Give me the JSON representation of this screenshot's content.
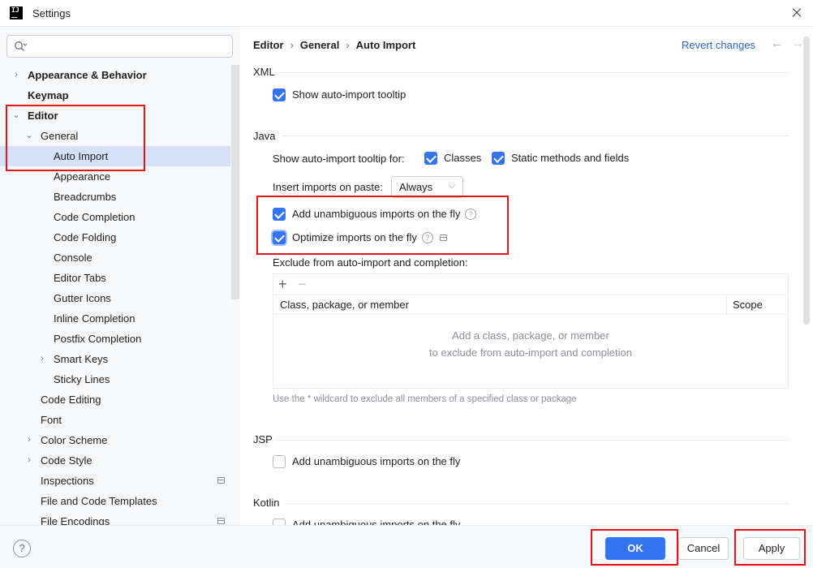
{
  "window": {
    "title": "Settings"
  },
  "search": {
    "placeholder": ""
  },
  "sidebar": {
    "items": [
      {
        "label": "Appearance & Behavior",
        "level": 0,
        "bold": true,
        "expandable": true,
        "expanded": false
      },
      {
        "label": "Keymap",
        "level": 0,
        "bold": true,
        "expandable": false
      },
      {
        "label": "Editor",
        "level": 0,
        "bold": true,
        "expandable": true,
        "expanded": true
      },
      {
        "label": "General",
        "level": 1,
        "bold": false,
        "expandable": true,
        "expanded": true
      },
      {
        "label": "Auto Import",
        "level": 2,
        "bold": false,
        "selected": true
      },
      {
        "label": "Appearance",
        "level": 2
      },
      {
        "label": "Breadcrumbs",
        "level": 2
      },
      {
        "label": "Code Completion",
        "level": 2
      },
      {
        "label": "Code Folding",
        "level": 2
      },
      {
        "label": "Console",
        "level": 2
      },
      {
        "label": "Editor Tabs",
        "level": 2
      },
      {
        "label": "Gutter Icons",
        "level": 2
      },
      {
        "label": "Inline Completion",
        "level": 2
      },
      {
        "label": "Postfix Completion",
        "level": 2
      },
      {
        "label": "Smart Keys",
        "level": 2,
        "expandable": true,
        "expanded": false
      },
      {
        "label": "Sticky Lines",
        "level": 2
      },
      {
        "label": "Code Editing",
        "level": 1
      },
      {
        "label": "Font",
        "level": 1
      },
      {
        "label": "Color Scheme",
        "level": 1,
        "expandable": true,
        "expanded": false
      },
      {
        "label": "Code Style",
        "level": 1,
        "expandable": true,
        "expanded": false
      },
      {
        "label": "Inspections",
        "level": 1,
        "side_icon": true
      },
      {
        "label": "File and Code Templates",
        "level": 1
      },
      {
        "label": "File Encodings",
        "level": 1,
        "side_icon": true
      }
    ]
  },
  "header": {
    "breadcrumb": [
      "Editor",
      "General",
      "Auto Import"
    ],
    "revert_label": "Revert changes"
  },
  "xml": {
    "title": "XML",
    "show_tooltip": {
      "label": "Show auto-import tooltip",
      "checked": true
    }
  },
  "java": {
    "title": "Java",
    "tooltip_for_label": "Show auto-import tooltip for:",
    "classes": {
      "label": "Classes",
      "checked": true
    },
    "static_methods": {
      "label": "Static methods and fields",
      "checked": true
    },
    "insert_on_paste_label": "Insert imports on paste:",
    "insert_on_paste_value": "Always",
    "add_unambiguous": {
      "label": "Add unambiguous imports on the fly",
      "checked": true
    },
    "optimize_imports": {
      "label": "Optimize imports on the fly",
      "checked": true
    },
    "exclude_label": "Exclude from auto-import and completion:",
    "table": {
      "col_member": "Class, package, or member",
      "col_scope": "Scope",
      "empty_line1": "Add a class, package, or member",
      "empty_line2": "to exclude from auto-import and completion"
    },
    "hint": "Use the * wildcard to exclude all members of a specified class or package"
  },
  "jsp": {
    "title": "JSP",
    "add_unambiguous": {
      "label": "Add unambiguous imports on the fly",
      "checked": false
    }
  },
  "kotlin": {
    "title": "Kotlin",
    "add_unambiguous": {
      "label": "Add unambiguous imports on the fly",
      "checked": false
    }
  },
  "footer": {
    "help_label": "?",
    "ok_label": "OK",
    "cancel_label": "Cancel",
    "apply_label": "Apply"
  },
  "colors": {
    "accent": "#3574f0",
    "link": "#2e63c7",
    "selection": "#d5e1f7",
    "annotation_red": "#e8131a"
  }
}
